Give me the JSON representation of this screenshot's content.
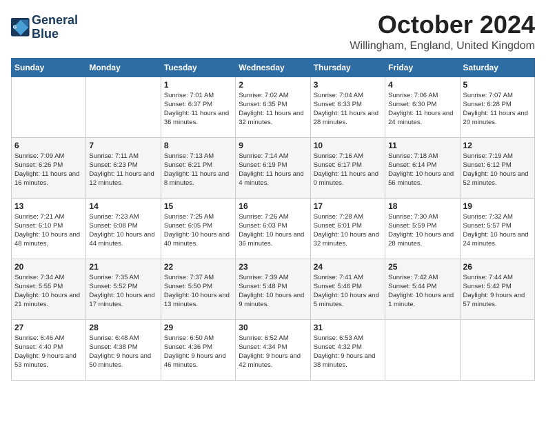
{
  "logo": {
    "line1": "General",
    "line2": "Blue"
  },
  "title": "October 2024",
  "location": "Willingham, England, United Kingdom",
  "days_of_week": [
    "Sunday",
    "Monday",
    "Tuesday",
    "Wednesday",
    "Thursday",
    "Friday",
    "Saturday"
  ],
  "weeks": [
    [
      {
        "day": "",
        "info": ""
      },
      {
        "day": "",
        "info": ""
      },
      {
        "day": "1",
        "info": "Sunrise: 7:01 AM\nSunset: 6:37 PM\nDaylight: 11 hours\nand 36 minutes."
      },
      {
        "day": "2",
        "info": "Sunrise: 7:02 AM\nSunset: 6:35 PM\nDaylight: 11 hours\nand 32 minutes."
      },
      {
        "day": "3",
        "info": "Sunrise: 7:04 AM\nSunset: 6:33 PM\nDaylight: 11 hours\nand 28 minutes."
      },
      {
        "day": "4",
        "info": "Sunrise: 7:06 AM\nSunset: 6:30 PM\nDaylight: 11 hours\nand 24 minutes."
      },
      {
        "day": "5",
        "info": "Sunrise: 7:07 AM\nSunset: 6:28 PM\nDaylight: 11 hours\nand 20 minutes."
      }
    ],
    [
      {
        "day": "6",
        "info": "Sunrise: 7:09 AM\nSunset: 6:26 PM\nDaylight: 11 hours\nand 16 minutes."
      },
      {
        "day": "7",
        "info": "Sunrise: 7:11 AM\nSunset: 6:23 PM\nDaylight: 11 hours\nand 12 minutes."
      },
      {
        "day": "8",
        "info": "Sunrise: 7:13 AM\nSunset: 6:21 PM\nDaylight: 11 hours\nand 8 minutes."
      },
      {
        "day": "9",
        "info": "Sunrise: 7:14 AM\nSunset: 6:19 PM\nDaylight: 11 hours\nand 4 minutes."
      },
      {
        "day": "10",
        "info": "Sunrise: 7:16 AM\nSunset: 6:17 PM\nDaylight: 11 hours\nand 0 minutes."
      },
      {
        "day": "11",
        "info": "Sunrise: 7:18 AM\nSunset: 6:14 PM\nDaylight: 10 hours\nand 56 minutes."
      },
      {
        "day": "12",
        "info": "Sunrise: 7:19 AM\nSunset: 6:12 PM\nDaylight: 10 hours\nand 52 minutes."
      }
    ],
    [
      {
        "day": "13",
        "info": "Sunrise: 7:21 AM\nSunset: 6:10 PM\nDaylight: 10 hours\nand 48 minutes."
      },
      {
        "day": "14",
        "info": "Sunrise: 7:23 AM\nSunset: 6:08 PM\nDaylight: 10 hours\nand 44 minutes."
      },
      {
        "day": "15",
        "info": "Sunrise: 7:25 AM\nSunset: 6:05 PM\nDaylight: 10 hours\nand 40 minutes."
      },
      {
        "day": "16",
        "info": "Sunrise: 7:26 AM\nSunset: 6:03 PM\nDaylight: 10 hours\nand 36 minutes."
      },
      {
        "day": "17",
        "info": "Sunrise: 7:28 AM\nSunset: 6:01 PM\nDaylight: 10 hours\nand 32 minutes."
      },
      {
        "day": "18",
        "info": "Sunrise: 7:30 AM\nSunset: 5:59 PM\nDaylight: 10 hours\nand 28 minutes."
      },
      {
        "day": "19",
        "info": "Sunrise: 7:32 AM\nSunset: 5:57 PM\nDaylight: 10 hours\nand 24 minutes."
      }
    ],
    [
      {
        "day": "20",
        "info": "Sunrise: 7:34 AM\nSunset: 5:55 PM\nDaylight: 10 hours\nand 21 minutes."
      },
      {
        "day": "21",
        "info": "Sunrise: 7:35 AM\nSunset: 5:52 PM\nDaylight: 10 hours\nand 17 minutes."
      },
      {
        "day": "22",
        "info": "Sunrise: 7:37 AM\nSunset: 5:50 PM\nDaylight: 10 hours\nand 13 minutes."
      },
      {
        "day": "23",
        "info": "Sunrise: 7:39 AM\nSunset: 5:48 PM\nDaylight: 10 hours\nand 9 minutes."
      },
      {
        "day": "24",
        "info": "Sunrise: 7:41 AM\nSunset: 5:46 PM\nDaylight: 10 hours\nand 5 minutes."
      },
      {
        "day": "25",
        "info": "Sunrise: 7:42 AM\nSunset: 5:44 PM\nDaylight: 10 hours\nand 1 minute."
      },
      {
        "day": "26",
        "info": "Sunrise: 7:44 AM\nSunset: 5:42 PM\nDaylight: 9 hours\nand 57 minutes."
      }
    ],
    [
      {
        "day": "27",
        "info": "Sunrise: 6:46 AM\nSunset: 4:40 PM\nDaylight: 9 hours\nand 53 minutes."
      },
      {
        "day": "28",
        "info": "Sunrise: 6:48 AM\nSunset: 4:38 PM\nDaylight: 9 hours\nand 50 minutes."
      },
      {
        "day": "29",
        "info": "Sunrise: 6:50 AM\nSunset: 4:36 PM\nDaylight: 9 hours\nand 46 minutes."
      },
      {
        "day": "30",
        "info": "Sunrise: 6:52 AM\nSunset: 4:34 PM\nDaylight: 9 hours\nand 42 minutes."
      },
      {
        "day": "31",
        "info": "Sunrise: 6:53 AM\nSunset: 4:32 PM\nDaylight: 9 hours\nand 38 minutes."
      },
      {
        "day": "",
        "info": ""
      },
      {
        "day": "",
        "info": ""
      }
    ]
  ]
}
